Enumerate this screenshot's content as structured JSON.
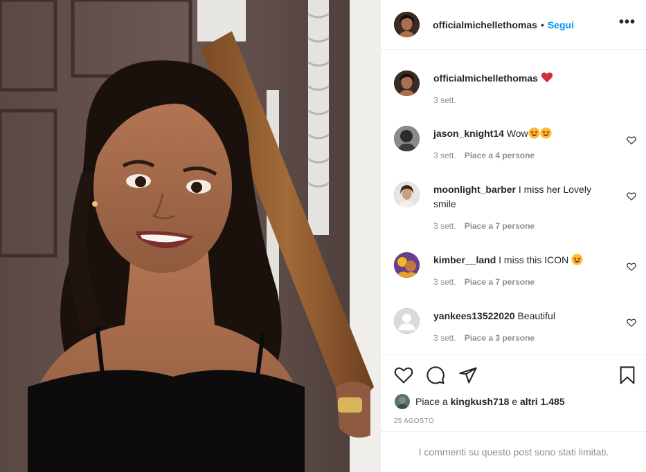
{
  "post": {
    "author": "officialmichellethomas",
    "follow_label": "Segui",
    "separator": "•",
    "more_label": "•••",
    "caption_time": "3 sett."
  },
  "comments": [
    {
      "user": "jason_knight14",
      "text": "Wow",
      "emoji_count": 2,
      "time": "3 sett.",
      "likes": "Piace a 4 persone"
    },
    {
      "user": "moonlight_barber",
      "text": "I miss her Lovely smile",
      "emoji_count": 0,
      "time": "3 sett.",
      "likes": "Piace a 7 persone"
    },
    {
      "user": "kimber__land",
      "text": "I miss this ICON",
      "emoji_count": 1,
      "time": "3 sett.",
      "likes": "Piace a 7 persone"
    },
    {
      "user": "yankees13522020",
      "text": "Beautiful",
      "emoji_count": 0,
      "time": "3 sett.",
      "likes": "Piace a 3 persone"
    }
  ],
  "likes_summary": {
    "prefix": "Piace a ",
    "user": "kingkush718",
    "middle": " e ",
    "others": "altri 1.485"
  },
  "post_date": "25 AGOSTO",
  "comments_limited": "I commenti su questo post sono stati limitati.",
  "icons": {
    "like": "heart-outline-icon",
    "comment": "comment-bubble-icon",
    "share": "paper-plane-icon",
    "save": "bookmark-icon",
    "more": "more-options-icon"
  },
  "colors": {
    "accent": "#0095f6",
    "text": "#262626",
    "muted": "#8e8e8e",
    "heart": "#ed4956",
    "border": "#efefef"
  }
}
